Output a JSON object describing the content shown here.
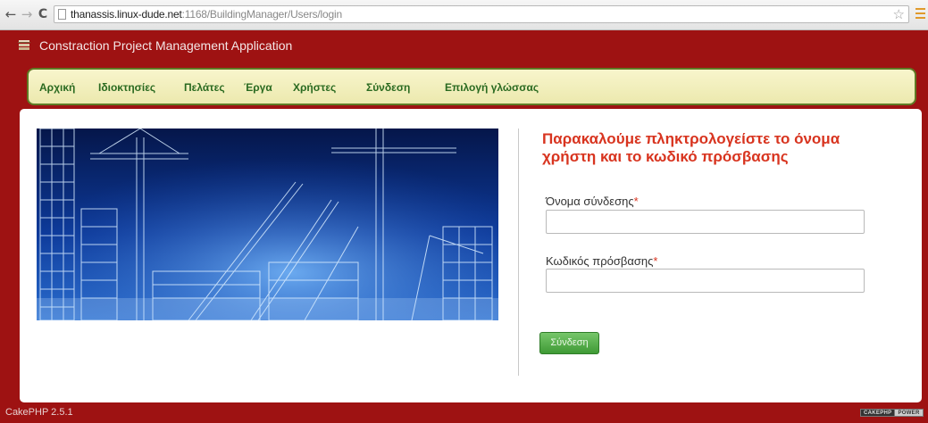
{
  "browser": {
    "url_host": "thanassis.linux-dude.net",
    "url_path": ":1168/BuildingManager/Users/login",
    "back_icon": "←",
    "forward_icon": "→",
    "reload_icon": "C",
    "star_icon": "☆"
  },
  "header": {
    "app_title": "Constraction Project Management Application"
  },
  "nav": {
    "items": [
      {
        "label": "Αρχική"
      },
      {
        "label": "Ιδιοκτησίες"
      },
      {
        "label": "Πελάτες"
      },
      {
        "label": "Έργα"
      },
      {
        "label": "Χρήστες"
      },
      {
        "label": "Σύνδεση"
      },
      {
        "label": "Επιλογή γλώσσας"
      }
    ]
  },
  "login": {
    "heading": "Παρακαλούμε πληκτρολογείστε το όνομα χρήστη και το κωδικό πρόσβασης",
    "username_label": "Όνομα σύνδεσης",
    "username_value": "",
    "password_label": "Κωδικός πρόσβασης",
    "password_value": "",
    "required_mark": "*",
    "submit_label": "Σύνδεση"
  },
  "footer": {
    "version": "CakePHP 2.5.1",
    "badge_left": "CAKEPHP",
    "badge_right": "POWER"
  },
  "colors": {
    "page_background": "#9e1212",
    "nav_text": "#2a6a20",
    "heading": "#d8341f",
    "button": "#4fa845"
  }
}
